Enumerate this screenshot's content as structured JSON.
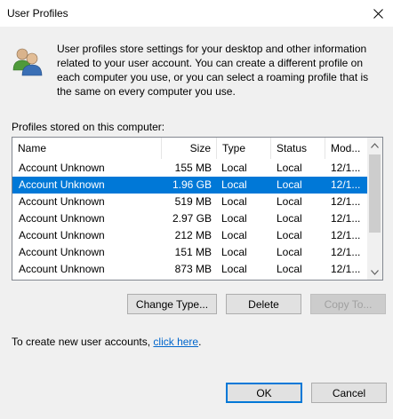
{
  "window": {
    "title": "User Profiles"
  },
  "intro": {
    "text": "User profiles store settings for your desktop and other information related to your user account. You can create a different profile on each computer you use, or you can select a roaming profile that is the same on every computer you use."
  },
  "profiles_label": "Profiles stored on this computer:",
  "table": {
    "columns": [
      "Name",
      "Size",
      "Type",
      "Status",
      "Mod..."
    ],
    "rows": [
      {
        "name": "Account Unknown",
        "size": "155 MB",
        "type": "Local",
        "status": "Local",
        "mod": "12/1..."
      },
      {
        "name": "Account Unknown",
        "size": "1.96 GB",
        "type": "Local",
        "status": "Local",
        "mod": "12/1..."
      },
      {
        "name": "Account Unknown",
        "size": "519 MB",
        "type": "Local",
        "status": "Local",
        "mod": "12/1..."
      },
      {
        "name": "Account Unknown",
        "size": "2.97 GB",
        "type": "Local",
        "status": "Local",
        "mod": "12/1..."
      },
      {
        "name": "Account Unknown",
        "size": "212 MB",
        "type": "Local",
        "status": "Local",
        "mod": "12/1..."
      },
      {
        "name": "Account Unknown",
        "size": "151 MB",
        "type": "Local",
        "status": "Local",
        "mod": "12/1..."
      },
      {
        "name": "Account Unknown",
        "size": "873 MB",
        "type": "Local",
        "status": "Local",
        "mod": "12/1..."
      }
    ],
    "selected_index": 1
  },
  "buttons": {
    "change_type": "Change Type...",
    "delete": "Delete",
    "copy_to": "Copy To...",
    "ok": "OK",
    "cancel": "Cancel"
  },
  "create": {
    "prefix": "To create new user accounts, ",
    "link": "click here",
    "suffix": "."
  },
  "colors": {
    "selection": "#0078d7",
    "link": "#0066cc"
  },
  "icons": {
    "close": "close-icon",
    "users": "users-icon"
  }
}
